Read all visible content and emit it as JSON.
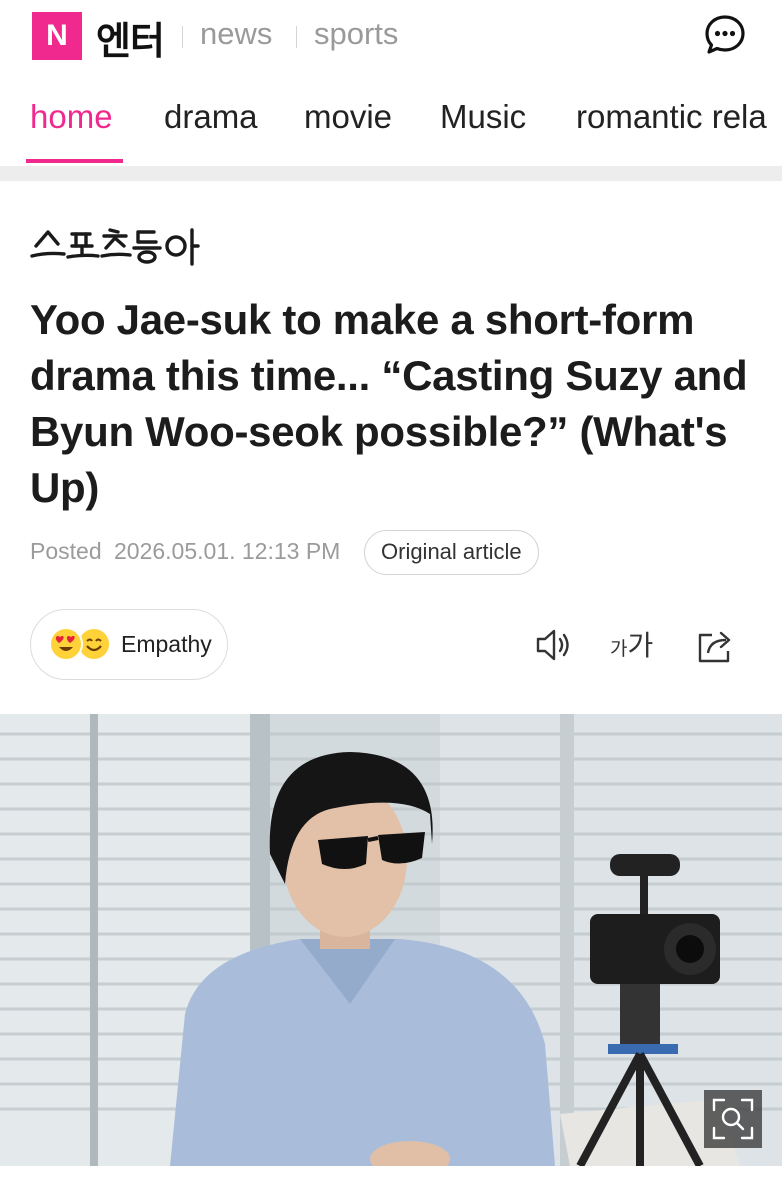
{
  "header": {
    "logo_letter": "N",
    "brand": "엔터",
    "sections": [
      "news",
      "sports"
    ]
  },
  "tabs": [
    {
      "label": "home",
      "active": true
    },
    {
      "label": "drama",
      "active": false
    },
    {
      "label": "movie",
      "active": false
    },
    {
      "label": "Music",
      "active": false
    },
    {
      "label": "romantic rela",
      "active": false
    }
  ],
  "article": {
    "publisher": "스포츠동아",
    "headline": "Yoo Jae-suk to make a short-form drama this time... “Casting Suzy and Byun Woo-seok possible?” (What's Up)",
    "posted_label": "Posted",
    "posted_date": "2026.05.01. 12:13 PM",
    "original_article_label": "Original article",
    "empathy_label": "Empathy",
    "font_size_label_small": "가",
    "font_size_label_large": "가"
  },
  "icons": {
    "chat": "chat-bubble-icon",
    "speaker": "speaker-icon",
    "share": "share-icon",
    "zoom": "zoom-search-icon"
  },
  "colors": {
    "accent": "#f0298f",
    "muted": "#9b9b9b",
    "divider": "#ededed"
  }
}
